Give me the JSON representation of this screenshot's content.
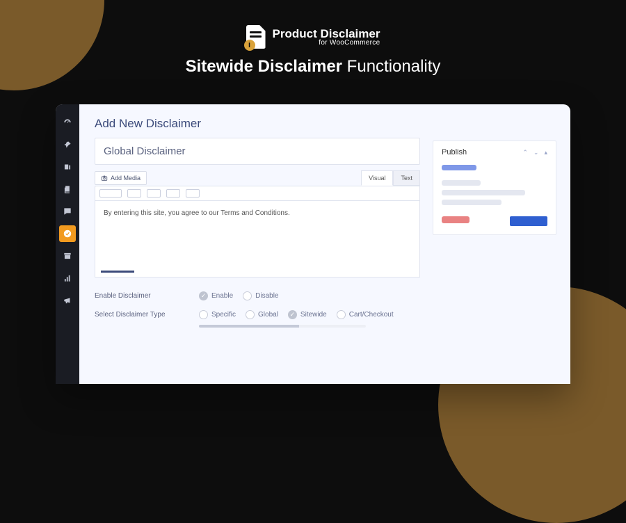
{
  "brand": {
    "product_name": "Product Disclaimer",
    "product_sub": "for WooCommerce",
    "tagline_strong": "Sitewide Disclaimer",
    "tagline_rest": " Functionality"
  },
  "sidebar": {
    "items": [
      {
        "name": "dashboard-icon",
        "active": false
      },
      {
        "name": "pin-icon",
        "active": false
      },
      {
        "name": "media-icon",
        "active": false
      },
      {
        "name": "pages-icon",
        "active": false
      },
      {
        "name": "comments-icon",
        "active": false
      },
      {
        "name": "disclaimer-icon",
        "active": true
      },
      {
        "name": "archive-icon",
        "active": false
      },
      {
        "name": "analytics-icon",
        "active": false
      },
      {
        "name": "marketing-icon",
        "active": false
      }
    ]
  },
  "page": {
    "title": "Add New Disclaimer",
    "title_input": "Global Disclaimer",
    "add_media_label": "Add Media",
    "tabs": {
      "visual": "Visual",
      "text": "Text"
    },
    "body_text": "By entering this site, you agree to our Terms and Conditions."
  },
  "options": {
    "enable": {
      "label": "Enable Disclaimer",
      "choices": [
        {
          "label": "Enable",
          "checked": true
        },
        {
          "label": "Disable",
          "checked": false
        }
      ]
    },
    "type": {
      "label": "Select Disclaimer Type",
      "choices": [
        {
          "label": "Specific",
          "checked": false
        },
        {
          "label": "Global",
          "checked": false
        },
        {
          "label": "Sitewide",
          "checked": true
        },
        {
          "label": "Cart/Checkout",
          "checked": false
        }
      ]
    }
  },
  "publish": {
    "title": "Publish"
  }
}
